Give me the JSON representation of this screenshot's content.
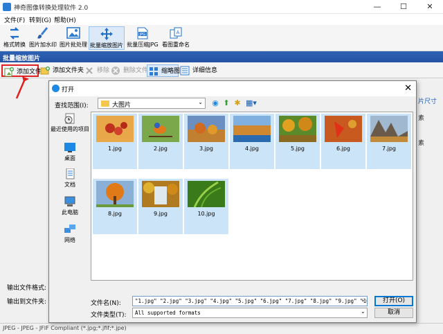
{
  "window": {
    "title": "神奇图像转换处理软件 2.0",
    "minimize": "—",
    "maximize": "☐",
    "close": "✕"
  },
  "menu": [
    "文件(F)",
    "转到(G)",
    "帮助(H)"
  ],
  "toolbar": [
    {
      "label": "格式转换",
      "icon": "convert-icon"
    },
    {
      "label": "图片加水印",
      "icon": "brush-icon"
    },
    {
      "label": "图片批处理",
      "icon": "image-icon"
    },
    {
      "label": "批量缩放图片",
      "icon": "move-icon",
      "active": true
    },
    {
      "label": "批量压缩JPG",
      "icon": "jpg-icon"
    },
    {
      "label": "看图重命名",
      "icon": "rename-icon"
    }
  ],
  "section_title": "批量缩放图片",
  "subtoolbar": [
    {
      "label": "添加文件",
      "icon": "add-file-icon"
    },
    {
      "label": "添加文件夹",
      "icon": "add-folder-icon"
    },
    {
      "label": "移除",
      "icon": "remove-icon",
      "disabled": true
    },
    {
      "label": "删除文件",
      "icon": "delete-icon",
      "disabled": true
    },
    {
      "label": "缩略图",
      "icon": "thumbnail-icon",
      "selected": true
    },
    {
      "label": "详细信息",
      "icon": "details-icon"
    }
  ],
  "right_panel": {
    "l1": "片尺寸",
    "l2": "素",
    "l3": "素"
  },
  "bottom": {
    "output_format_label": "输出文件格式:",
    "output_folder_label": "输出到文件夹:",
    "status": "JPEG - JPEG - JFIF Compliant (*.jpg;*.jfif;*.jpe)"
  },
  "dialog": {
    "title": "打开",
    "look_in_label": "查找范围(I):",
    "look_in_value": "大图片",
    "places": [
      "最近使用的项目",
      "桌面",
      "文档",
      "此电脑",
      "网络"
    ],
    "files": [
      "1.jpg",
      "2.jpg",
      "3.jpg",
      "4.jpg",
      "5.jpg",
      "6.jpg",
      "7.jpg",
      "8.jpg",
      "9.jpg",
      "10.jpg"
    ],
    "filename_label": "文件名(N):",
    "filename_value": "\"1.jpg\" \"2.jpg\" \"3.jpg\" \"4.jpg\" \"5.jpg\" \"6.jpg\" \"7.jpg\" \"8.jpg\" \"9.jpg\" \"10.jpg\"",
    "filetype_label": "文件类型(T):",
    "filetype_value": "All supported formats",
    "open_button": "打开(O)",
    "cancel_button": "取消"
  },
  "colors": {
    "accent": "#2552a3",
    "selection": "#cce4f7",
    "highlight": "#e02020"
  }
}
